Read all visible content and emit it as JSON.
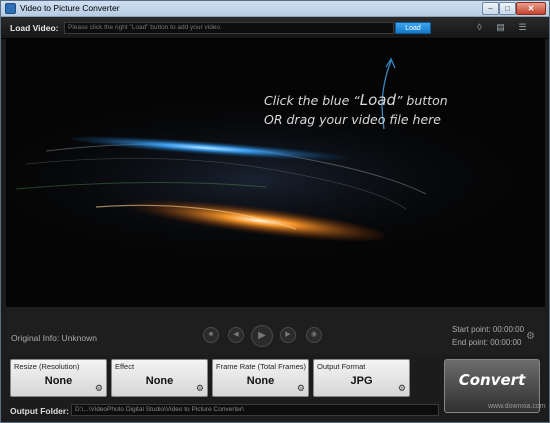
{
  "titlebar": {
    "title": "Video to Picture Converter",
    "min_glyph": "–",
    "max_glyph": "□",
    "close_glyph": "✕"
  },
  "loadbar": {
    "label": "Load Video:",
    "placeholder": "Please click the right \"Load\" button to add your video.",
    "load_button": "Load"
  },
  "preview": {
    "hint_line1_a": "Click the blue “",
    "hint_line1_load": "Load",
    "hint_line1_b": "” button",
    "hint_line2": "OR drag your video file here"
  },
  "info": {
    "original_info": "Original Info: Unknown",
    "start_point": "Start point: 00:00:00",
    "end_point": "End point: 00:00:00"
  },
  "options": [
    {
      "title": "Resize (Resolution)",
      "value": "None"
    },
    {
      "title": "Effect",
      "value": "None"
    },
    {
      "title": "Frame Rate (Total Frames)",
      "value": "None"
    },
    {
      "title": "Output Format",
      "value": "JPG"
    }
  ],
  "convert_label": "Convert",
  "output": {
    "label": "Output Folder:",
    "path": "D:\\...\\VideoPhoto Digital Studio\\Video to Picture Converter\\"
  },
  "watermark": "www.downxia.com",
  "colors": {
    "load_button": "#1f8ee0",
    "background": "#1c1c1c",
    "swoosh_blue": "#3da8ff",
    "swoosh_orange": "#ff8a1e"
  }
}
